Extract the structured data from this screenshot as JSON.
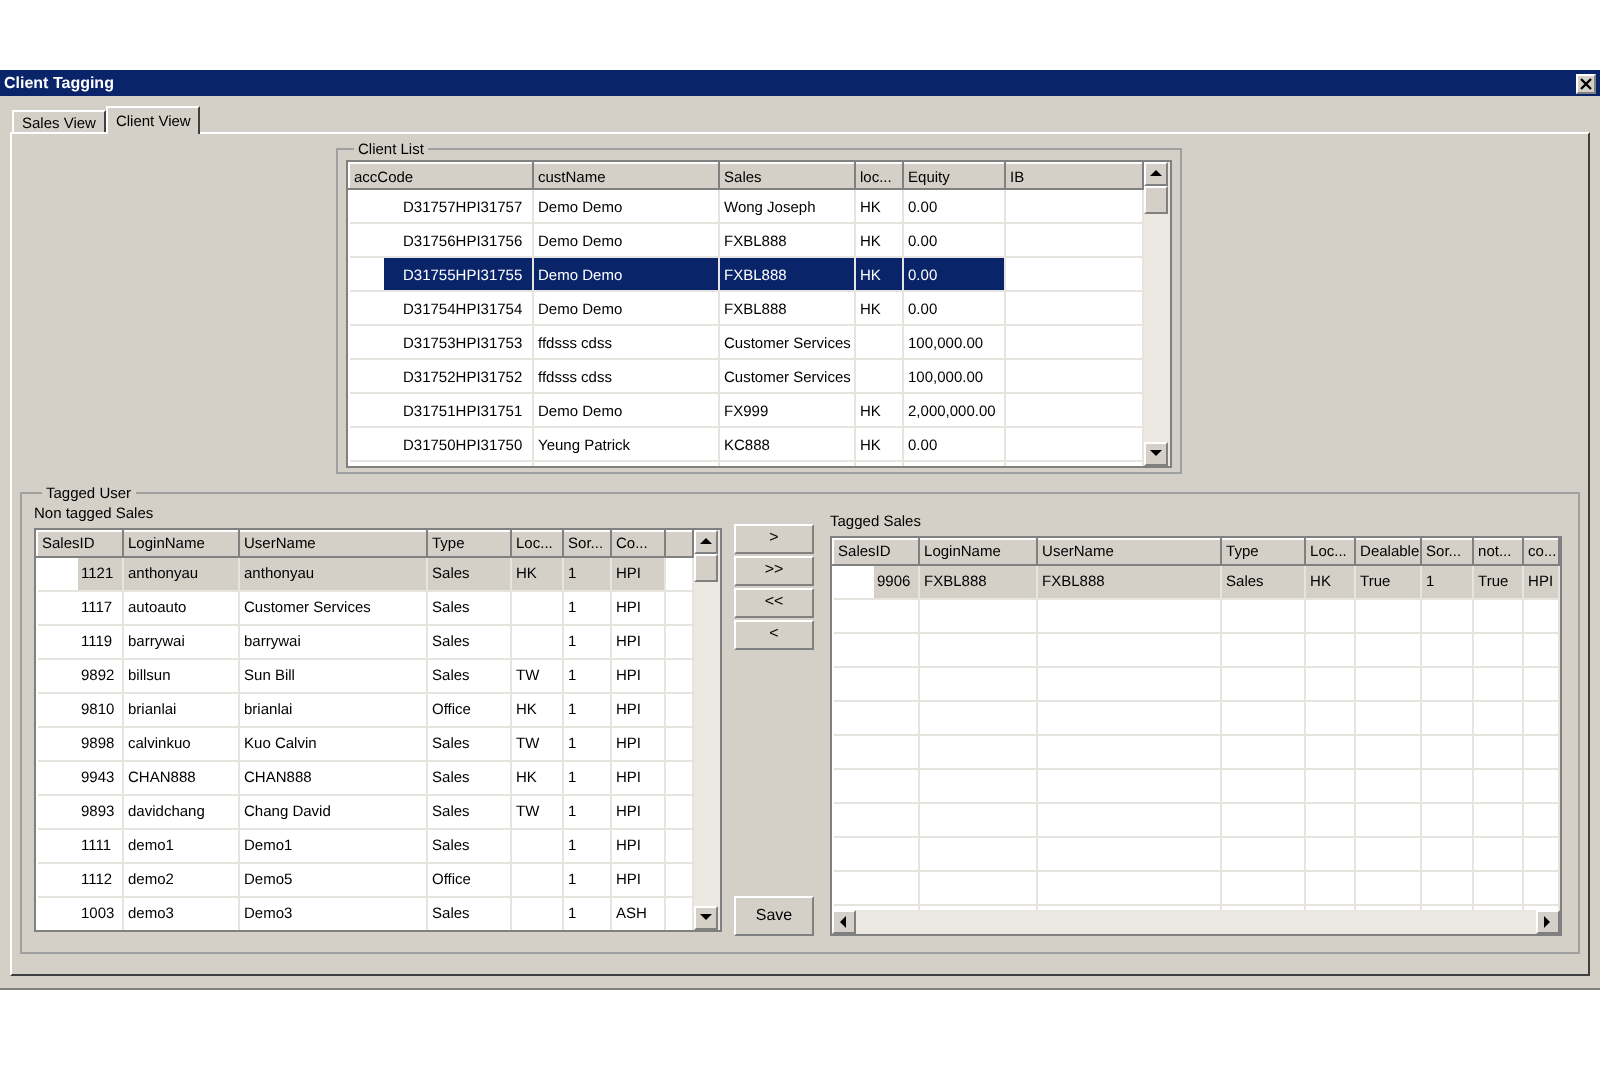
{
  "window": {
    "title": "Client Tagging"
  },
  "tabs": [
    {
      "label": "Sales View",
      "selected": false
    },
    {
      "label": "Client View",
      "selected": true
    }
  ],
  "client_list": {
    "title": "Client List",
    "columns": [
      "accCode",
      "custName",
      "Sales",
      "loc...",
      "Equity",
      "IB"
    ],
    "rows": [
      {
        "selected": false,
        "cells": [
          "D31757HPI31757",
          "Demo Demo",
          "Wong Joseph",
          "HK",
          "0.00",
          ""
        ]
      },
      {
        "selected": false,
        "cells": [
          "D31756HPI31756",
          "Demo Demo",
          "FXBL888",
          "HK",
          "0.00",
          ""
        ]
      },
      {
        "selected": true,
        "cells": [
          "D31755HPI31755",
          "Demo Demo",
          "FXBL888",
          "HK",
          "0.00",
          ""
        ]
      },
      {
        "selected": false,
        "cells": [
          "D31754HPI31754",
          "Demo Demo",
          "FXBL888",
          "HK",
          "0.00",
          ""
        ]
      },
      {
        "selected": false,
        "cells": [
          "D31753HPI31753",
          "ffdsss cdss",
          "Customer Services",
          "",
          "100,000.00",
          ""
        ]
      },
      {
        "selected": false,
        "cells": [
          "D31752HPI31752",
          "ffdsss cdss",
          "Customer Services",
          "",
          "100,000.00",
          ""
        ]
      },
      {
        "selected": false,
        "cells": [
          "D31751HPI31751",
          "Demo Demo",
          "FX999",
          "HK",
          "2,000,000.00",
          ""
        ]
      },
      {
        "selected": false,
        "cells": [
          "D31750HPI31750",
          "Yeung Patrick",
          "KC888",
          "HK",
          "0.00",
          ""
        ]
      }
    ]
  },
  "tagged_user": {
    "title": "Tagged User",
    "non_tagged_sales": {
      "label": "Non tagged Sales",
      "columns": [
        "SalesID",
        "LoginName",
        "UserName",
        "Type",
        "Loc...",
        "Sor...",
        "Co...",
        ""
      ],
      "rows": [
        {
          "selected": true,
          "cells": [
            "1121",
            "anthonyau",
            "anthonyau",
            "Sales",
            "HK",
            "1",
            "HPI",
            ""
          ]
        },
        {
          "selected": false,
          "cells": [
            "1117",
            "autoauto",
            "Customer Services",
            "Sales",
            "",
            "1",
            "HPI",
            ""
          ]
        },
        {
          "selected": false,
          "cells": [
            "1119",
            "barrywai",
            "barrywai",
            "Sales",
            "",
            "1",
            "HPI",
            ""
          ]
        },
        {
          "selected": false,
          "cells": [
            "9892",
            "billsun",
            "Sun Bill",
            "Sales",
            "TW",
            "1",
            "HPI",
            ""
          ]
        },
        {
          "selected": false,
          "cells": [
            "9810",
            "brianlai",
            "brianlai",
            "Office",
            "HK",
            "1",
            "HPI",
            ""
          ]
        },
        {
          "selected": false,
          "cells": [
            "9898",
            "calvinkuo",
            "Kuo Calvin",
            "Sales",
            "TW",
            "1",
            "HPI",
            ""
          ]
        },
        {
          "selected": false,
          "cells": [
            "9943",
            "CHAN888",
            "CHAN888",
            "Sales",
            "HK",
            "1",
            "HPI",
            ""
          ]
        },
        {
          "selected": false,
          "cells": [
            "9893",
            "davidchang",
            "Chang David",
            "Sales",
            "TW",
            "1",
            "HPI",
            ""
          ]
        },
        {
          "selected": false,
          "cells": [
            "1111",
            "demo1",
            "Demo1",
            "Sales",
            "",
            "1",
            "HPI",
            ""
          ]
        },
        {
          "selected": false,
          "cells": [
            "1112",
            "demo2",
            "Demo5",
            "Office",
            "",
            "1",
            "HPI",
            ""
          ]
        },
        {
          "selected": false,
          "cells": [
            "1003",
            "demo3",
            "Demo3",
            "Sales",
            "",
            "1",
            "ASH",
            ""
          ]
        }
      ]
    },
    "move_buttons": [
      ">",
      ">>",
      "<<",
      "<"
    ],
    "save_button": "Save",
    "tagged_sales": {
      "label": "Tagged Sales",
      "columns": [
        "SalesID",
        "LoginName",
        "UserName",
        "Type",
        "Loc...",
        "Dealable",
        "Sor...",
        "not...",
        "co..."
      ],
      "rows": [
        {
          "selected": true,
          "cells": [
            "9906",
            "FXBL888",
            "FXBL888",
            "Sales",
            "HK",
            "True",
            "1",
            "True",
            "HPI"
          ]
        }
      ]
    }
  }
}
